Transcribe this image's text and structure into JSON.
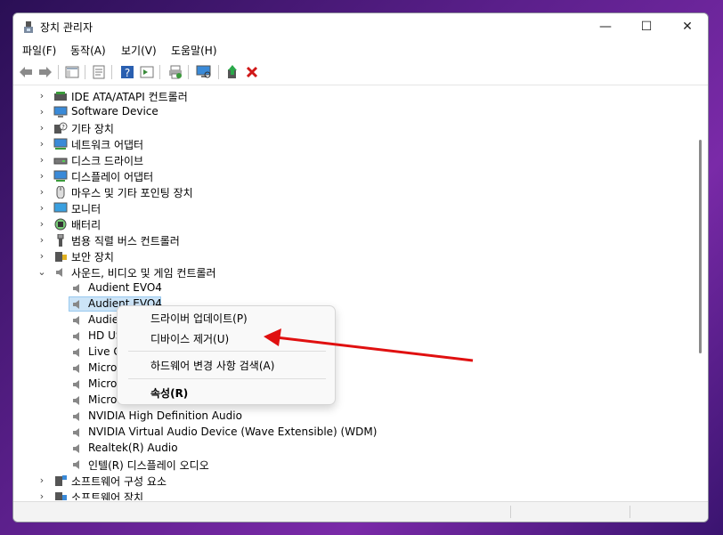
{
  "window": {
    "title": "장치 관리자",
    "minimize": "—",
    "maximize": "☐",
    "close": "✕"
  },
  "menu": [
    "파일(F)",
    "동작(A)",
    "보기(V)",
    "도움말(H)"
  ],
  "tree": {
    "items": [
      {
        "label": "IDE ATA/ATAPI 컨트롤러",
        "icon": "ide-controller-icon",
        "level": 0,
        "expander": "collapsed"
      },
      {
        "label": "Software Device",
        "icon": "software-device-icon",
        "level": 0,
        "expander": "collapsed"
      },
      {
        "label": "기타 장치",
        "icon": "other-devices-icon",
        "level": 0,
        "expander": "collapsed"
      },
      {
        "label": "네트워크 어댑터",
        "icon": "network-adapter-icon",
        "level": 0,
        "expander": "collapsed"
      },
      {
        "label": "디스크 드라이브",
        "icon": "disk-drive-icon",
        "level": 0,
        "expander": "collapsed"
      },
      {
        "label": "디스플레이 어댑터",
        "icon": "display-adapter-icon",
        "level": 0,
        "expander": "collapsed"
      },
      {
        "label": "마우스 및 기타 포인팅 장치",
        "icon": "mouse-icon",
        "level": 0,
        "expander": "collapsed"
      },
      {
        "label": "모니터",
        "icon": "monitor-icon",
        "level": 0,
        "expander": "collapsed"
      },
      {
        "label": "배터리",
        "icon": "battery-icon",
        "level": 0,
        "expander": "collapsed"
      },
      {
        "label": "범용 직렬 버스 컨트롤러",
        "icon": "usb-icon",
        "level": 0,
        "expander": "collapsed"
      },
      {
        "label": "보안 장치",
        "icon": "security-device-icon",
        "level": 0,
        "expander": "collapsed"
      },
      {
        "label": "사운드, 비디오 및 게임 컨트롤러",
        "icon": "speaker-icon",
        "level": 0,
        "expander": "expanded"
      },
      {
        "label": "Audient EVO4",
        "icon": "speaker-icon",
        "level": 1,
        "expander": ""
      },
      {
        "label": "Audient EVO4",
        "icon": "speaker-icon",
        "level": 1,
        "expander": "",
        "selected": true
      },
      {
        "label": "Audie",
        "icon": "speaker-icon",
        "level": 1,
        "expander": ""
      },
      {
        "label": "HD US",
        "icon": "speaker-icon",
        "level": 1,
        "expander": ""
      },
      {
        "label": "Live G",
        "icon": "speaker-icon",
        "level": 1,
        "expander": ""
      },
      {
        "label": "Micro",
        "icon": "speaker-icon",
        "level": 1,
        "expander": ""
      },
      {
        "label": "Micro",
        "icon": "speaker-icon",
        "level": 1,
        "expander": ""
      },
      {
        "label": "Micro",
        "icon": "speaker-icon",
        "level": 1,
        "expander": ""
      },
      {
        "label": "NVIDIA High Definition Audio",
        "icon": "speaker-icon",
        "level": 1,
        "expander": ""
      },
      {
        "label": "NVIDIA Virtual Audio Device (Wave Extensible) (WDM)",
        "icon": "speaker-icon",
        "level": 1,
        "expander": ""
      },
      {
        "label": "Realtek(R) Audio",
        "icon": "speaker-icon",
        "level": 1,
        "expander": ""
      },
      {
        "label": "인텔(R) 디스플레이 오디오",
        "icon": "speaker-icon",
        "level": 1,
        "expander": ""
      },
      {
        "label": "소프트웨어 구성 요소",
        "icon": "software-component-icon",
        "level": 0,
        "expander": "collapsed"
      },
      {
        "label": "소프트웨어 장치",
        "icon": "software-device-icon",
        "level": 0,
        "expander": "collapsed"
      }
    ]
  },
  "context_menu": {
    "update_driver": "드라이버 업데이트(P)",
    "uninstall_device": "디바이스 제거(U)",
    "scan_hardware": "하드웨어 변경 사항 검색(A)",
    "properties": "속성(R)"
  },
  "annotation": {
    "color": "#e01010",
    "icon": "red-arrow"
  }
}
